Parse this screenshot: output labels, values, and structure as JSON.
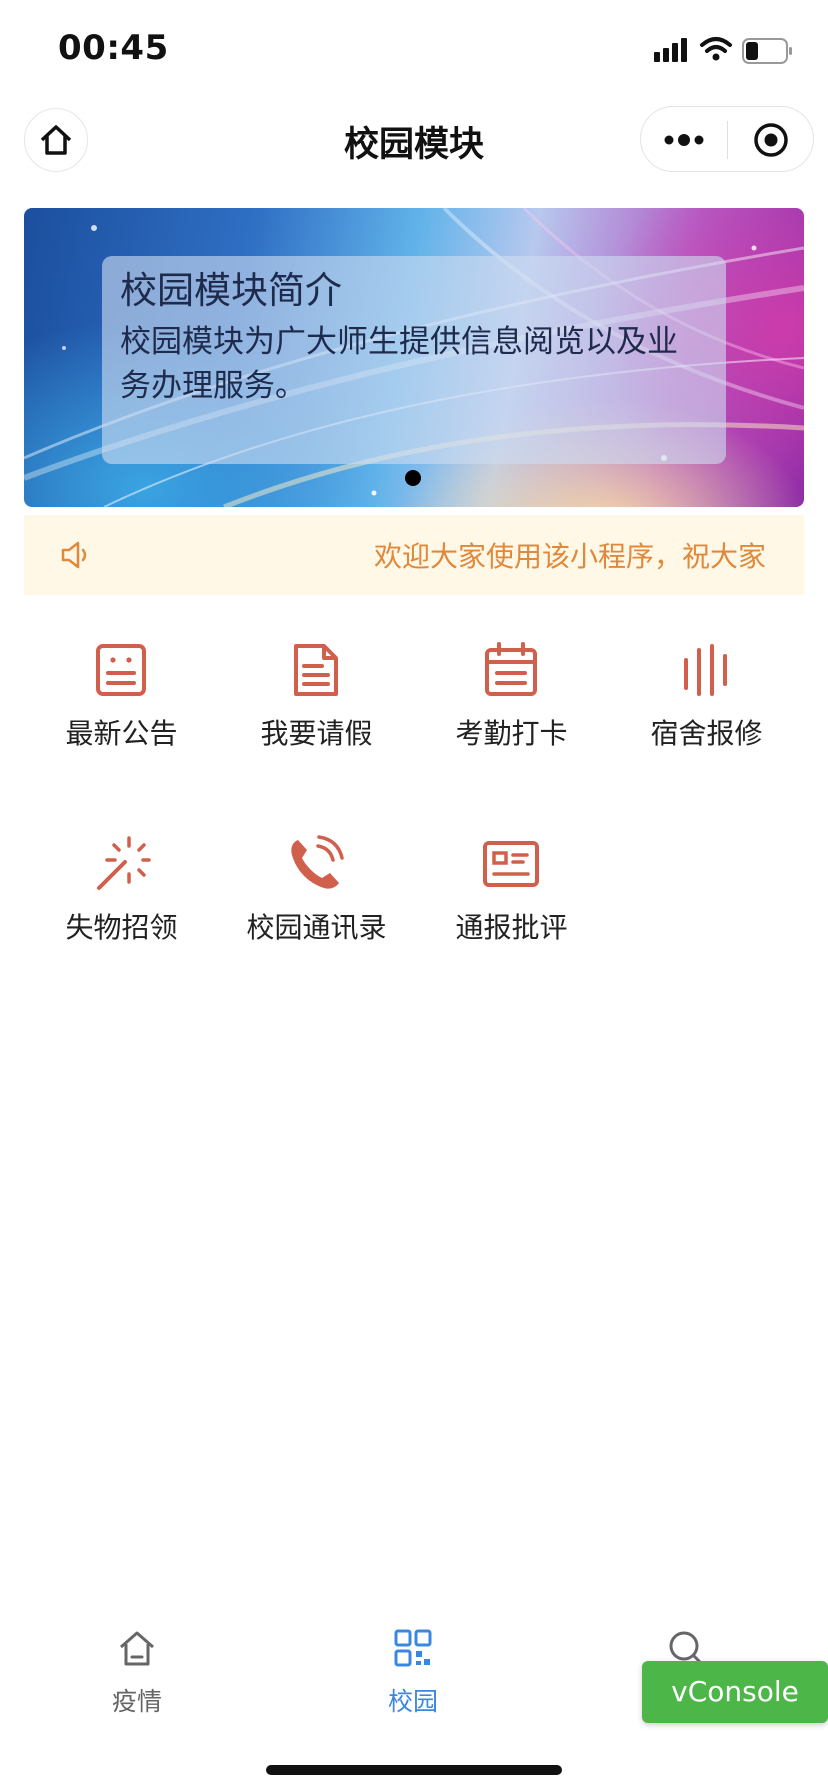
{
  "status_bar": {
    "time": "00:45"
  },
  "nav": {
    "title": "校园模块"
  },
  "banner": {
    "title": "校园模块简介",
    "description_line1": "校园模块为广大师生提供信息阅览以及业",
    "description_line2": "务办理服务。"
  },
  "notice": {
    "text": "欢迎大家使用该小程序，祝大家"
  },
  "grid": {
    "items": [
      {
        "label": "最新公告",
        "icon": "notice-board-icon"
      },
      {
        "label": "我要请假",
        "icon": "document-icon"
      },
      {
        "label": "考勤打卡",
        "icon": "calendar-icon"
      },
      {
        "label": "宿舍报修",
        "icon": "bars-icon"
      },
      {
        "label": "失物招领",
        "icon": "magic-wand-icon"
      },
      {
        "label": "校园通讯录",
        "icon": "phone-icon"
      },
      {
        "label": "通报批评",
        "icon": "id-card-icon"
      }
    ]
  },
  "tabbar": {
    "items": [
      {
        "label": "疫情",
        "icon": "home-icon",
        "active": false
      },
      {
        "label": "校园",
        "icon": "qr-code-icon",
        "active": true
      },
      {
        "label": "",
        "icon": "search-icon",
        "active": false
      }
    ]
  },
  "vconsole": {
    "label": "vConsole"
  },
  "colors": {
    "icon_accent": "#d0604c",
    "tab_active": "#3b87e0",
    "tab_inactive": "#666666",
    "notice_text": "#e0893a",
    "notice_bg": "#fff8e6",
    "vconsole_bg": "#4cb748"
  }
}
